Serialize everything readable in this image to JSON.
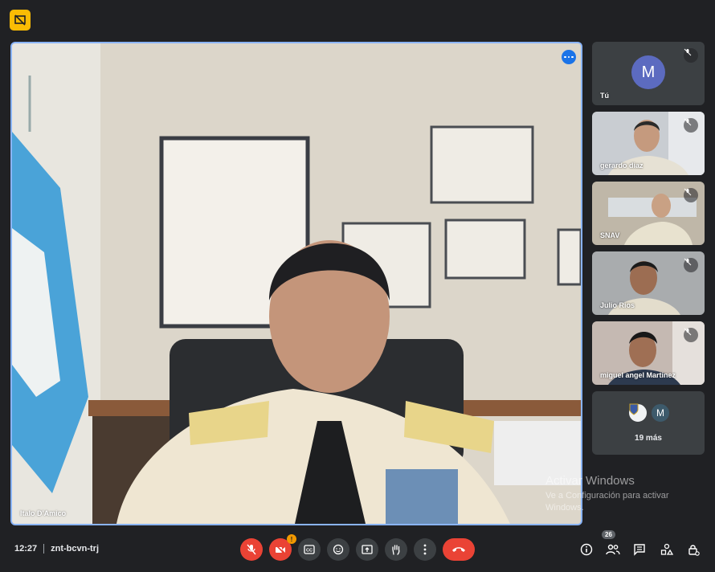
{
  "main": {
    "speaker_name": "Italo D'Amico"
  },
  "watermark": {
    "title": "Activar Windows",
    "subtitle": "Ve a Configuración para activar Windows."
  },
  "participants": [
    {
      "name": "Tú",
      "avatar_letter": "M",
      "muted": true
    },
    {
      "name": "gerardo diaz",
      "muted": true
    },
    {
      "name": "SNAV",
      "muted": true
    },
    {
      "name": "Julio Rios",
      "muted": true
    },
    {
      "name": "miguel angel Martinez",
      "muted": true
    }
  ],
  "more_tile": {
    "avatar_letter": "M",
    "label": "19 más"
  },
  "bottom_bar": {
    "time": "12:27",
    "meeting_code": "znt-bcvn-trj",
    "alert_count": "!",
    "people_count": "26"
  },
  "icons": [
    "presentation-off-icon",
    "more-options-icon",
    "mic-off-icon",
    "camera-off-icon",
    "captions-icon",
    "emoji-icon",
    "present-screen-icon",
    "raise-hand-icon",
    "more-vert-icon",
    "end-call-icon",
    "info-icon",
    "people-icon",
    "chat-icon",
    "activities-icon",
    "host-controls-icon"
  ],
  "colors": {
    "background": "#202124",
    "accent": "#8ab4f8",
    "danger": "#ea4335",
    "badge": "#fbbc04"
  }
}
